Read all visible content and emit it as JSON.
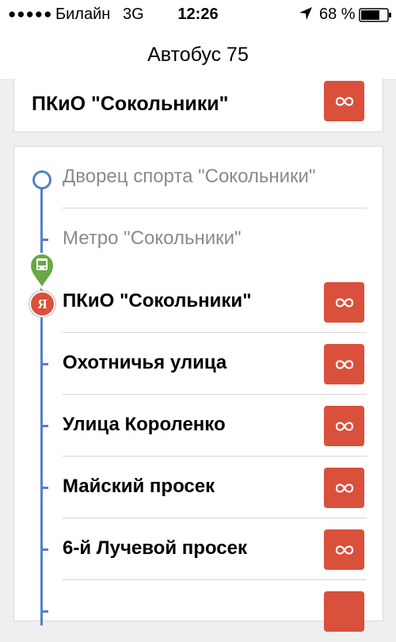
{
  "status_bar": {
    "signal": "●●●●●",
    "carrier": "Билайн",
    "network": "3G",
    "time": "12:26",
    "battery": "68 %",
    "location_icon": "location-arrow-icon",
    "battery_icon": "battery-icon"
  },
  "nav": {
    "title": "Автобус 75"
  },
  "current_stop_card": {
    "name": "ПКиО \"Сокольники\"",
    "action_icon": "infinity-icon"
  },
  "route": {
    "stops": [
      {
        "name": "Дворец спорта \"Сокольники\"",
        "state": "past"
      },
      {
        "name": "Метро \"Сокольники\"",
        "state": "past"
      },
      {
        "name": "ПКиО \"Сокольники\"",
        "state": "current"
      },
      {
        "name": "Охотничья улица",
        "state": "upcoming"
      },
      {
        "name": "Улица Короленко",
        "state": "upcoming"
      },
      {
        "name": "Майский просек",
        "state": "upcoming"
      },
      {
        "name": "6-й Лучевой просек",
        "state": "upcoming"
      }
    ],
    "bus_marker_icon": "bus-icon",
    "user_marker_icon": "yandex-pin-icon",
    "user_marker_text": "Я"
  },
  "colors": {
    "accent_red": "#d9503c",
    "route_blue": "#5480c8",
    "bus_green": "#6aa846"
  }
}
